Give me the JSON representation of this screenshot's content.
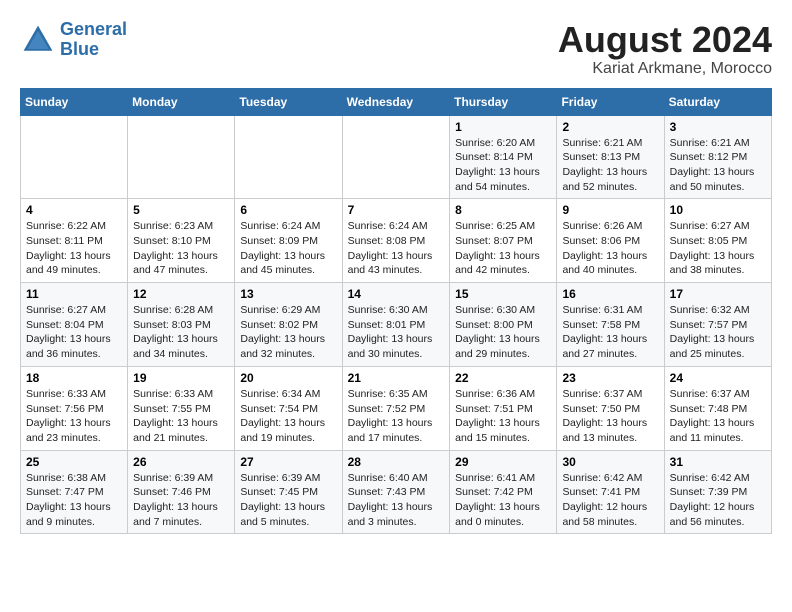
{
  "header": {
    "logo_line1": "General",
    "logo_line2": "Blue",
    "month_year": "August 2024",
    "location": "Kariat Arkmane, Morocco"
  },
  "days_of_week": [
    "Sunday",
    "Monday",
    "Tuesday",
    "Wednesday",
    "Thursday",
    "Friday",
    "Saturday"
  ],
  "weeks": [
    [
      {
        "day": "",
        "info": ""
      },
      {
        "day": "",
        "info": ""
      },
      {
        "day": "",
        "info": ""
      },
      {
        "day": "",
        "info": ""
      },
      {
        "day": "1",
        "info": "Sunrise: 6:20 AM\nSunset: 8:14 PM\nDaylight: 13 hours\nand 54 minutes."
      },
      {
        "day": "2",
        "info": "Sunrise: 6:21 AM\nSunset: 8:13 PM\nDaylight: 13 hours\nand 52 minutes."
      },
      {
        "day": "3",
        "info": "Sunrise: 6:21 AM\nSunset: 8:12 PM\nDaylight: 13 hours\nand 50 minutes."
      }
    ],
    [
      {
        "day": "4",
        "info": "Sunrise: 6:22 AM\nSunset: 8:11 PM\nDaylight: 13 hours\nand 49 minutes."
      },
      {
        "day": "5",
        "info": "Sunrise: 6:23 AM\nSunset: 8:10 PM\nDaylight: 13 hours\nand 47 minutes."
      },
      {
        "day": "6",
        "info": "Sunrise: 6:24 AM\nSunset: 8:09 PM\nDaylight: 13 hours\nand 45 minutes."
      },
      {
        "day": "7",
        "info": "Sunrise: 6:24 AM\nSunset: 8:08 PM\nDaylight: 13 hours\nand 43 minutes."
      },
      {
        "day": "8",
        "info": "Sunrise: 6:25 AM\nSunset: 8:07 PM\nDaylight: 13 hours\nand 42 minutes."
      },
      {
        "day": "9",
        "info": "Sunrise: 6:26 AM\nSunset: 8:06 PM\nDaylight: 13 hours\nand 40 minutes."
      },
      {
        "day": "10",
        "info": "Sunrise: 6:27 AM\nSunset: 8:05 PM\nDaylight: 13 hours\nand 38 minutes."
      }
    ],
    [
      {
        "day": "11",
        "info": "Sunrise: 6:27 AM\nSunset: 8:04 PM\nDaylight: 13 hours\nand 36 minutes."
      },
      {
        "day": "12",
        "info": "Sunrise: 6:28 AM\nSunset: 8:03 PM\nDaylight: 13 hours\nand 34 minutes."
      },
      {
        "day": "13",
        "info": "Sunrise: 6:29 AM\nSunset: 8:02 PM\nDaylight: 13 hours\nand 32 minutes."
      },
      {
        "day": "14",
        "info": "Sunrise: 6:30 AM\nSunset: 8:01 PM\nDaylight: 13 hours\nand 30 minutes."
      },
      {
        "day": "15",
        "info": "Sunrise: 6:30 AM\nSunset: 8:00 PM\nDaylight: 13 hours\nand 29 minutes."
      },
      {
        "day": "16",
        "info": "Sunrise: 6:31 AM\nSunset: 7:58 PM\nDaylight: 13 hours\nand 27 minutes."
      },
      {
        "day": "17",
        "info": "Sunrise: 6:32 AM\nSunset: 7:57 PM\nDaylight: 13 hours\nand 25 minutes."
      }
    ],
    [
      {
        "day": "18",
        "info": "Sunrise: 6:33 AM\nSunset: 7:56 PM\nDaylight: 13 hours\nand 23 minutes."
      },
      {
        "day": "19",
        "info": "Sunrise: 6:33 AM\nSunset: 7:55 PM\nDaylight: 13 hours\nand 21 minutes."
      },
      {
        "day": "20",
        "info": "Sunrise: 6:34 AM\nSunset: 7:54 PM\nDaylight: 13 hours\nand 19 minutes."
      },
      {
        "day": "21",
        "info": "Sunrise: 6:35 AM\nSunset: 7:52 PM\nDaylight: 13 hours\nand 17 minutes."
      },
      {
        "day": "22",
        "info": "Sunrise: 6:36 AM\nSunset: 7:51 PM\nDaylight: 13 hours\nand 15 minutes."
      },
      {
        "day": "23",
        "info": "Sunrise: 6:37 AM\nSunset: 7:50 PM\nDaylight: 13 hours\nand 13 minutes."
      },
      {
        "day": "24",
        "info": "Sunrise: 6:37 AM\nSunset: 7:48 PM\nDaylight: 13 hours\nand 11 minutes."
      }
    ],
    [
      {
        "day": "25",
        "info": "Sunrise: 6:38 AM\nSunset: 7:47 PM\nDaylight: 13 hours\nand 9 minutes."
      },
      {
        "day": "26",
        "info": "Sunrise: 6:39 AM\nSunset: 7:46 PM\nDaylight: 13 hours\nand 7 minutes."
      },
      {
        "day": "27",
        "info": "Sunrise: 6:39 AM\nSunset: 7:45 PM\nDaylight: 13 hours\nand 5 minutes."
      },
      {
        "day": "28",
        "info": "Sunrise: 6:40 AM\nSunset: 7:43 PM\nDaylight: 13 hours\nand 3 minutes."
      },
      {
        "day": "29",
        "info": "Sunrise: 6:41 AM\nSunset: 7:42 PM\nDaylight: 13 hours\nand 0 minutes."
      },
      {
        "day": "30",
        "info": "Sunrise: 6:42 AM\nSunset: 7:41 PM\nDaylight: 12 hours\nand 58 minutes."
      },
      {
        "day": "31",
        "info": "Sunrise: 6:42 AM\nSunset: 7:39 PM\nDaylight: 12 hours\nand 56 minutes."
      }
    ]
  ]
}
